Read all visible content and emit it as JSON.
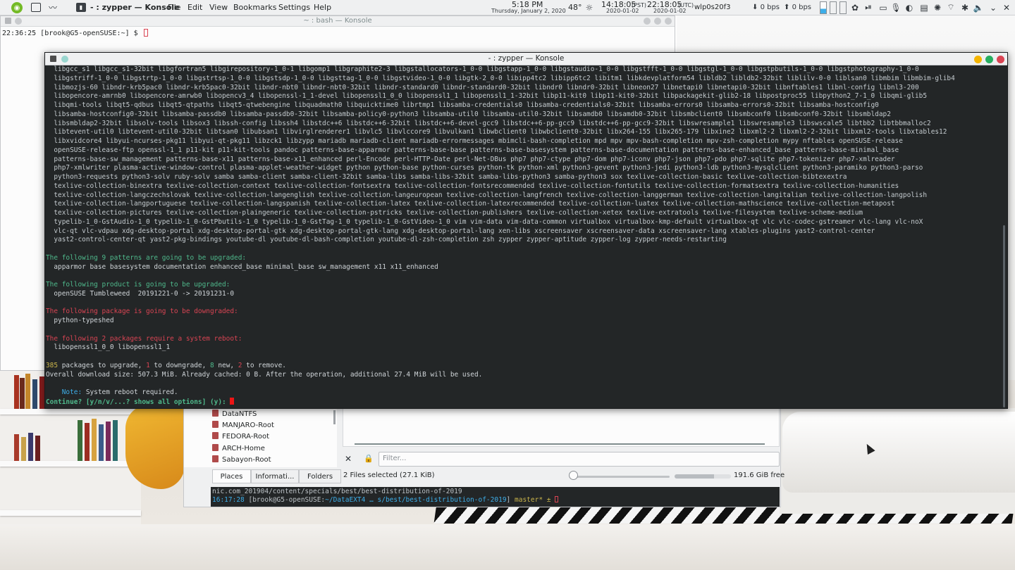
{
  "top_panel": {
    "task_title": "- : zypper — Konsole",
    "menus": [
      "File",
      "Edit",
      "View",
      "Bookmarks",
      "Settings",
      "Help"
    ],
    "clock_time": "5:18 PM",
    "clock_date": "Thursday, January 2, 2020",
    "weather": "48°",
    "clock2_time": "14:18:05",
    "clock2_zone": "(PST)",
    "clock2_date": "2020-01-02",
    "clock3_time": "22:18:05",
    "clock3_zone": "(UTC)",
    "clock3_date": "2020-01-02",
    "network_iface": "wlp0s20f3",
    "down_rate": "0 bps",
    "up_rate": "0 bps"
  },
  "bash_window": {
    "title": "~ : bash — Konsole",
    "prompt": "22:36:25 [brook@G5-openSUSE:~] $ "
  },
  "file_manager": {
    "places": [
      "DataNTFS",
      "MANJARO-Root",
      "FEDORA-Root",
      "ARCH-Home",
      "Sabayon-Root"
    ],
    "tabs": [
      "Places",
      "Informati...",
      "Folders"
    ],
    "filter_placeholder": "Filter...",
    "status": "2 Files selected (27.1 KiB)",
    "free_space": "191.6 GiB free",
    "zoom_fraction": 0.02,
    "used_fraction": 0.7,
    "term_line1": "nic.com_201904/content/specials/best/best-distribution-of-2019",
    "term_time": "16:17:28",
    "term_prompt_user": " [brook@G5-openSUSE:",
    "term_path": "~/DataEXT4 … s/best/best-distribution-of-2019",
    "term_prompt_end": "] ",
    "term_branch": "master* ±"
  },
  "zypper_window": {
    "title": "- : zypper — Konsole",
    "package_lines": [
      "libgcc_s1 libgcc_s1-32bit libgfortran5 libgirepository-1_0-1 libgomp1 libgraphite2-3 libgstallocators-1_0-0 libgstapp-1_0-0 libgstaudio-1_0-0 libgstfft-1_0-0 libgstgl-1_0-0 libgstpbutils-1_0-0 libgstphotography-1_0-0",
      "libgstriff-1_0-0 libgstrtp-1_0-0 libgstrtsp-1_0-0 libgstsdp-1_0-0 libgsttag-1_0-0 libgstvideo-1_0-0 libgtk-2_0-0 libipp4tc2 libipp6tc2 libitm1 libkdevplatform54 libldb2 libldb2-32bit liblilv-0-0 liblsan0 libmbim libmbim-glib4",
      "libmozjs-60 libndr-krb5pac0 libndr-krb5pac0-32bit libndr-nbt0 libndr-nbt0-32bit libndr-standard0 libndr-standard0-32bit libndr0 libndr0-32bit libneon27 libnetapi0 libnetapi0-32bit libnftables1 libnl-config libnl3-200",
      "libopencore-amrnb0 libopencore-amrwb0 libopencv3_4 libopenssl-1_1-devel libopenssl1_0_0 libopenssl1_1 libopenssl1_1-32bit libp11-kit0 libp11-kit0-32bit libpackagekit-glib2-18 libpostproc55 libpython2_7-1_0 libqmi-glib5",
      "libqmi-tools libqt5-qdbus libqt5-qtpaths libqt5-qtwebengine libquadmath0 libquicktime0 librtmp1 libsamba-credentials0 libsamba-credentials0-32bit libsamba-errors0 libsamba-errors0-32bit libsamba-hostconfig0",
      "libsamba-hostconfig0-32bit libsamba-passdb0 libsamba-passdb0-32bit libsamba-policy0-python3 libsamba-util0 libsamba-util0-32bit libsamdb0 libsamdb0-32bit libsmbclient0 libsmbconf0 libsmbconf0-32bit libsmbldap2",
      "libsmbldap2-32bit libsolv-tools libsox3 libssh-config libssh4 libstdc++6 libstdc++6-32bit libstdc++6-devel-gcc9 libstdc++6-pp-gcc9 libstdc++6-pp-gcc9-32bit libswresample1 libswresample3 libswscale5 libtbb2 libtbbmalloc2",
      "libtevent-util0 libtevent-util0-32bit libtsan0 libubsan1 libvirglrenderer1 libvlc5 libvlccore9 libvulkan1 libwbclient0 libwbclient0-32bit libx264-155 libx265-179 libxine2 libxml2-2 libxml2-2-32bit libxml2-tools libxtables12",
      "libxvidcore4 libyui-ncurses-pkg11 libyui-qt-pkg11 libzck1 libzypp mariadb mariadb-client mariadb-errormessages mbimcli-bash-completion mpd mpv mpv-bash-completion mpv-zsh-completion mypy nftables openSUSE-release",
      "openSUSE-release-ftp openssl-1_1 p11-kit p11-kit-tools pandoc patterns-base-apparmor patterns-base-base patterns-base-basesystem patterns-base-documentation patterns-base-enhanced_base patterns-base-minimal_base",
      "patterns-base-sw_management patterns-base-x11 patterns-base-x11_enhanced perl-Encode perl-HTTP-Date perl-Net-DBus php7 php7-ctype php7-dom php7-iconv php7-json php7-pdo php7-sqlite php7-tokenizer php7-xmlreader",
      "php7-xmlwriter plasma-active-window-control plasma-applet-weather-widget python python-base python-curses python-tk python-xml python3-gevent python3-jedi python3-ldb python3-mysqlclient python3-paramiko python3-parso",
      "python3-requests python3-solv ruby-solv samba samba-client samba-client-32bit samba-libs samba-libs-32bit samba-libs-python3 samba-python3 sox texlive-collection-basic texlive-collection-bibtexextra",
      "texlive-collection-binextra texlive-collection-context texlive-collection-fontsextra texlive-collection-fontsrecommended texlive-collection-fontutils texlive-collection-formatsextra texlive-collection-humanities",
      "texlive-collection-langczechslovak texlive-collection-langenglish texlive-collection-langeuropean texlive-collection-langfrench texlive-collection-langgerman texlive-collection-langitalian texlive-collection-langpolish",
      "texlive-collection-langportuguese texlive-collection-langspanish texlive-collection-latex texlive-collection-latexrecommended texlive-collection-luatex texlive-collection-mathscience texlive-collection-metapost",
      "texlive-collection-pictures texlive-collection-plaingeneric texlive-collection-pstricks texlive-collection-publishers texlive-collection-xetex texlive-extratools texlive-filesystem texlive-scheme-medium",
      "typelib-1_0-GstAudio-1_0 typelib-1_0-GstPbutils-1_0 typelib-1_0-GstTag-1_0 typelib-1_0-GstVideo-1_0 vim vim-data vim-data-common virtualbox virtualbox-kmp-default virtualbox-qt vlc vlc-codec-gstreamer vlc-lang vlc-noX",
      "vlc-qt vlc-vdpau xdg-desktop-portal xdg-desktop-portal-gtk xdg-desktop-portal-gtk-lang xdg-desktop-portal-lang xen-libs xscreensaver xscreensaver-data xscreensaver-lang xtables-plugins yast2-control-center",
      "yast2-control-center-qt yast2-pkg-bindings youtube-dl youtube-dl-bash-completion youtube-dl-zsh-completion zsh zypper zypper-aptitude zypper-log zypper-needs-restarting"
    ],
    "patterns_header": "The following 9 patterns are going to be upgraded:",
    "patterns_list": "  apparmor base basesystem documentation enhanced_base minimal_base sw_management x11 x11_enhanced",
    "product_header": "The following product is going to be upgraded:",
    "product_line": "  openSUSE Tumbleweed  20191221-0 -> 20191231-0",
    "downgrade_header": "The following package is going to be downgraded:",
    "downgrade_pkg": "  python-typeshed",
    "reboot_header": "The following 2 packages require a system reboot:",
    "reboot_pkgs": "  libopenssl1_0_0 libopenssl1_1",
    "summary_n1": "385",
    "summary_t1": " packages to upgrade, ",
    "summary_n2": "1",
    "summary_t2": " to downgrade, ",
    "summary_n3": "8",
    "summary_t3": " new, ",
    "summary_n4": "2",
    "summary_t4": " to remove.",
    "download_line": "Overall download size: 507.3 MiB. Already cached: 0 B. After the operation, additional 27.4 MiB will be used.",
    "note_label": "    Note:",
    "note_text": " System reboot required.",
    "continue_prompt": "Continue? [y/n/v/...? shows all options] (y): "
  }
}
